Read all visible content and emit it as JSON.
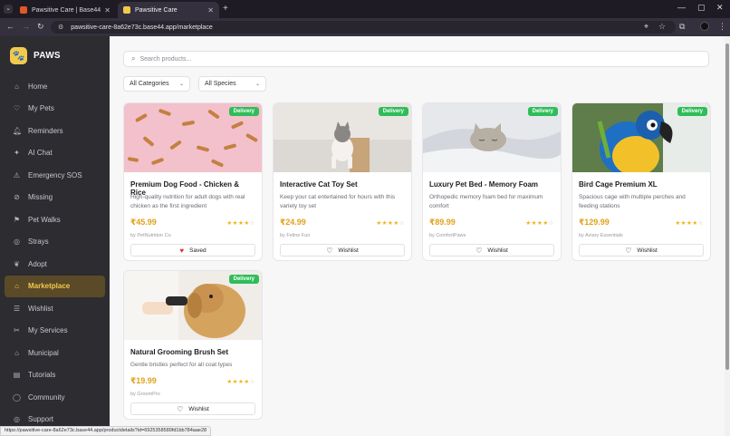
{
  "browser": {
    "tabs": [
      {
        "title": "Pawsitive Care | Base44",
        "active": false
      },
      {
        "title": "Pawsitive Care",
        "active": true
      }
    ],
    "url": "pawsitive-care-8a62e73c.base44.app/marketplace",
    "status_url": "https://pawsitive-care-8a62e73c.base44.app/productdetails?id=6925358589fd1bb784aae28"
  },
  "app": {
    "name": "PAWS",
    "accent": "#f2c94c"
  },
  "sidebar": {
    "items": [
      {
        "label": "Home",
        "icon": "home-icon"
      },
      {
        "label": "My Pets",
        "icon": "heart-icon"
      },
      {
        "label": "Reminders",
        "icon": "bell-icon"
      },
      {
        "label": "AI Chat",
        "icon": "sparkle-icon"
      },
      {
        "label": "Emergency SOS",
        "icon": "alert-icon"
      },
      {
        "label": "Missing",
        "icon": "search-circle-icon"
      },
      {
        "label": "Pet Walks",
        "icon": "walk-icon"
      },
      {
        "label": "Strays",
        "icon": "location-pin-icon"
      },
      {
        "label": "Adopt",
        "icon": "heart-handshake-icon"
      },
      {
        "label": "Marketplace",
        "icon": "shop-icon",
        "active": true
      },
      {
        "label": "Wishlist",
        "icon": "list-icon"
      },
      {
        "label": "My Services",
        "icon": "scissors-icon"
      },
      {
        "label": "Municipal",
        "icon": "building-icon"
      },
      {
        "label": "Tutorials",
        "icon": "book-icon"
      },
      {
        "label": "Community",
        "icon": "chat-icon"
      },
      {
        "label": "Support",
        "icon": "support-icon"
      }
    ]
  },
  "search": {
    "placeholder": "Search products..."
  },
  "filters": {
    "category": "All Categories",
    "species": "All Species"
  },
  "products": [
    {
      "title": "Premium Dog Food - Chicken & Rice",
      "desc": "High-quality nutrition for adult dogs with real chicken as the first ingredient",
      "price": "₹45.99",
      "rating": 4,
      "seller": "by PetNutrition Co",
      "button": "Saved",
      "saved": true,
      "badge": "Delivery"
    },
    {
      "title": "Interactive Cat Toy Set",
      "desc": "Keep your cat entertained for hours with this variety toy set",
      "price": "₹24.99",
      "rating": 4,
      "seller": "by Feline Fun",
      "button": "Wishlist",
      "saved": false,
      "badge": "Delivery"
    },
    {
      "title": "Luxury Pet Bed - Memory Foam",
      "desc": "Orthopedic memory foam bed for maximum comfort",
      "price": "₹89.99",
      "rating": 4,
      "seller": "by ComfortPaws",
      "button": "Wishlist",
      "saved": false,
      "badge": "Delivery"
    },
    {
      "title": "Bird Cage Premium XL",
      "desc": "Spacious cage with multiple perches and feeding stations",
      "price": "₹129.99",
      "rating": 4,
      "seller": "by Aviary Essentials",
      "button": "Wishlist",
      "saved": false,
      "badge": "Delivery"
    },
    {
      "title": "Natural Grooming Brush Set",
      "desc": "Gentle bristles perfect for all coat types",
      "price": "₹19.99",
      "rating": 4,
      "seller": "by GroomPro",
      "button": "Wishlist",
      "saved": false,
      "badge": "Delivery"
    }
  ]
}
